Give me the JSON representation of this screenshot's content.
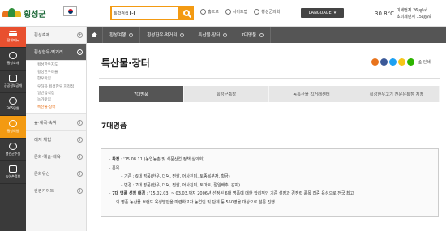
{
  "header": {
    "site_name": "횡성군",
    "search": {
      "select_value": "통합검색"
    },
    "top_links": [
      {
        "label": "홈으로"
      },
      {
        "label": "사이트맵"
      },
      {
        "label": "횡성군의회"
      }
    ],
    "language_label": "LANGUAGE",
    "weather": {
      "temperature": "30.8°C",
      "pm10": "미세먼지 26㎍/㎥",
      "pm25": "초미세먼지 15㎍/㎥"
    }
  },
  "rail": [
    {
      "label": "전체메뉴",
      "icon": "menu-icon"
    },
    {
      "label": "횡성소개",
      "icon": "info-icon"
    },
    {
      "label": "공공정보공개",
      "icon": "document-icon"
    },
    {
      "label": "365민원",
      "icon": "headset-icon"
    },
    {
      "label": "횡성여행",
      "icon": "travel-icon"
    },
    {
      "label": "열린군수실",
      "icon": "person-icon"
    },
    {
      "label": "농어촌정보",
      "icon": "farm-icon"
    }
  ],
  "submenu": {
    "items_top": [
      "횡성축제",
      "횡성한우·먹거리"
    ],
    "sub_items": [
      "횡성한우지도",
      "횡성한우마을",
      "한우맛집",
      "우하하 횡성한우 지정점",
      "일반음식점",
      "농가맛집",
      "특산물·장터"
    ],
    "items_bottom": [
      "숲·계곡·숙박",
      "레저 체험",
      "문화·예술·체육",
      "문화유산",
      "관광가이드"
    ]
  },
  "breadcrumb": [
    "횡성여행",
    "횡성한우·먹거리",
    "특산물·장터",
    "7대명품"
  ],
  "page_title": "특산물·장터",
  "print_label": "인쇄",
  "tabs": [
    "7대명품",
    "횡성군축장",
    "농특산물 직거래센터",
    "횡성한우고기 전문유통점 지정"
  ],
  "section_title": "7대명품",
  "info": {
    "l1_label": "확정",
    "l1_text": " : '15.08.11.(농업농촌 및 식품산업 정책 심의회)",
    "l2": "· 품목",
    "l3": "– 기존 : 6대 명품(한우, 더덕, 찐쌀, 어사진미, 토종복분자, 황금)",
    "l4": "– 변경 : 7대 명품(한우, 더덕, 찐쌀, 어사진미, 토마토, 절임배추, 감자)",
    "l5_label": "7대 명품 선정 배경",
    "l5_text": " : '15.02.03. ~ 03.03.까지 2006년 선정된 6대 명품에 대한 합리적인 기준 설정과 경쟁력 품목 집중 육성으로 전국 최고",
    "l6": "의 명품 농산물 브랜드 육성방안을 마련하고자 농업인 및 단체 등 550명을 대상으로 설문 진행"
  },
  "colors": {
    "accent": "#f39a12",
    "all_menu": "#e8502f",
    "rail_bg": "#3a3a3a",
    "crumb_bg": "#555555"
  }
}
